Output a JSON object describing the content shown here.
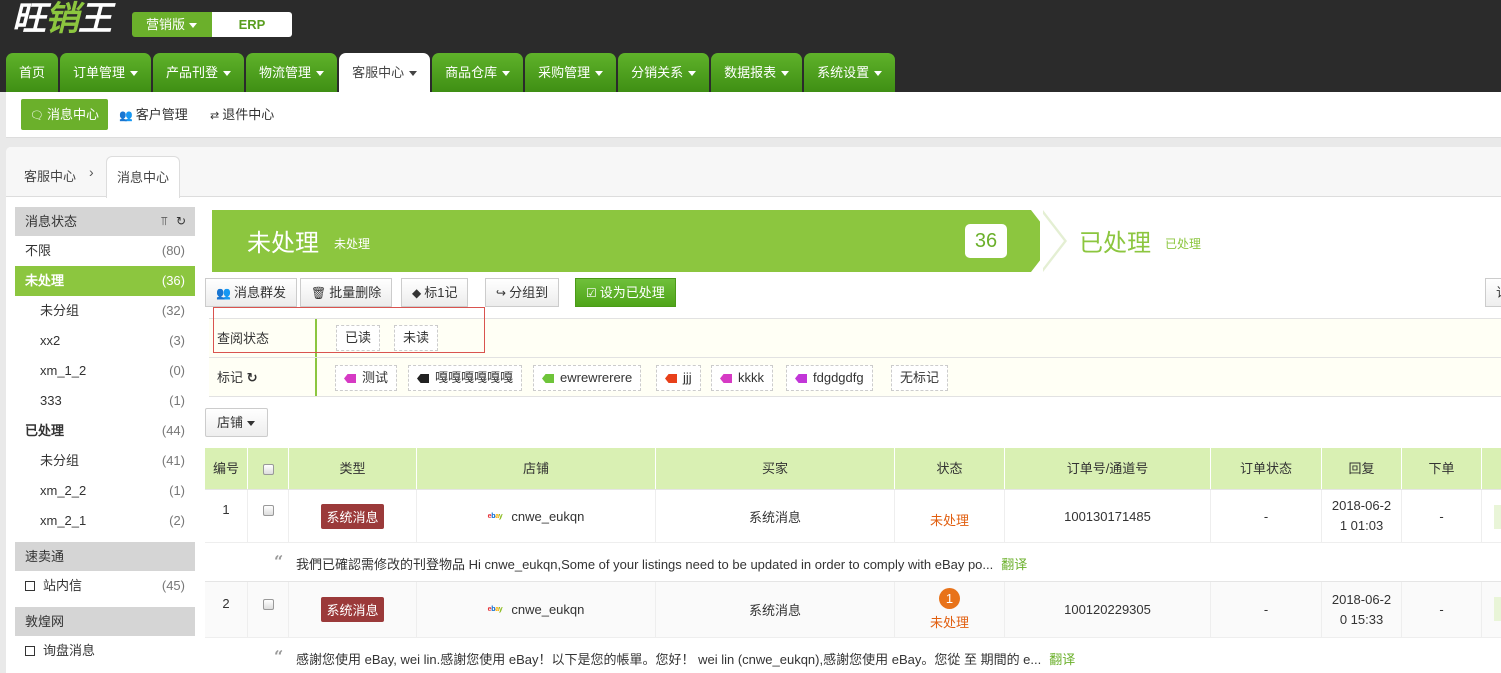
{
  "header": {
    "logo_main": "旺",
    "logo_accent": "销",
    "logo_end": "王",
    "version_label": "营销版",
    "erp_label": "ERP"
  },
  "nav": [
    {
      "label": "首页",
      "dropdown": false,
      "active": false
    },
    {
      "label": "订单管理",
      "dropdown": true,
      "active": false
    },
    {
      "label": "产品刊登",
      "dropdown": true,
      "active": false
    },
    {
      "label": "物流管理",
      "dropdown": true,
      "active": false
    },
    {
      "label": "客服中心",
      "dropdown": true,
      "active": true
    },
    {
      "label": "商品仓库",
      "dropdown": true,
      "active": false
    },
    {
      "label": "采购管理",
      "dropdown": true,
      "active": false
    },
    {
      "label": "分销关系",
      "dropdown": true,
      "active": false
    },
    {
      "label": "数据报表",
      "dropdown": true,
      "active": false
    },
    {
      "label": "系统设置",
      "dropdown": true,
      "active": false
    }
  ],
  "subnav": {
    "message_center": "消息中心",
    "customer_mgmt": "客户管理",
    "returns_center": "退件中心"
  },
  "breadcrumb": {
    "root": "客服中心",
    "sep": "›",
    "current": "消息中心"
  },
  "sidebar": {
    "status_header": "消息状态",
    "status_items": [
      {
        "label": "不限",
        "count": "(80)",
        "level": "top",
        "active": false,
        "bold": false
      },
      {
        "label": "未处理",
        "count": "(36)",
        "level": "top",
        "active": true,
        "bold": true
      },
      {
        "label": "未分组",
        "count": "(32)",
        "level": "sub",
        "active": false,
        "bold": false
      },
      {
        "label": "xx2",
        "count": "(3)",
        "level": "sub",
        "active": false,
        "bold": false
      },
      {
        "label": "xm_1_2",
        "count": "(0)",
        "level": "sub",
        "active": false,
        "bold": false
      },
      {
        "label": "333",
        "count": "(1)",
        "level": "sub",
        "active": false,
        "bold": false
      },
      {
        "label": "已处理",
        "count": "(44)",
        "level": "top",
        "active": false,
        "bold": true
      },
      {
        "label": "未分组",
        "count": "(41)",
        "level": "sub",
        "active": false,
        "bold": false
      },
      {
        "label": "xm_2_2",
        "count": "(1)",
        "level": "sub",
        "active": false,
        "bold": false
      },
      {
        "label": "xm_2_1",
        "count": "(2)",
        "level": "sub",
        "active": false,
        "bold": false
      }
    ],
    "aliexpress_header": "速卖通",
    "aliexpress_item": {
      "label": "站内信",
      "count": "(45)"
    },
    "dhgate_header": "敦煌网",
    "dhgate_item": {
      "label": "询盘消息",
      "count": ""
    }
  },
  "banner": {
    "unprocessed_title": "未处理",
    "unprocessed_sub": "未处理",
    "unprocessed_count": "36",
    "processed_title": "已处理",
    "processed_sub": "已处理"
  },
  "toolbar": {
    "bulk_send": "消息群发",
    "bulk_delete": "批量删除",
    "mark": "标1记",
    "group_to": "分组到",
    "set_processed": "设为已处理",
    "right_partial": "订"
  },
  "filters": {
    "read_label": "查阅状态",
    "read_options": [
      "已读",
      "未读"
    ],
    "tag_label": "标记",
    "tags": [
      {
        "label": "测试",
        "color": "#d63ac4"
      },
      {
        "label": "嘎嘎嘎嘎嘎嘎",
        "color": "#222222"
      },
      {
        "label": "ewrewrerere",
        "color": "#6ec43a"
      },
      {
        "label": "jjj",
        "color": "#e8401a"
      },
      {
        "label": "kkkk",
        "color": "#d63ac4"
      },
      {
        "label": "fdgdgdfg",
        "color": "#c236d8"
      }
    ],
    "no_tag": "无标记"
  },
  "store_dropdown": "店铺",
  "table": {
    "headers": [
      "编号",
      "",
      "类型",
      "店铺",
      "买家",
      "状态",
      "订单号/通道号",
      "订单状态",
      "回复",
      "下单"
    ],
    "rows": [
      {
        "num": "1",
        "type": "系统消息",
        "store": "cnwe_eukqn",
        "buyer": "系统消息",
        "unread": "",
        "status": "未处理",
        "order": "100130171485",
        "order_status": "-",
        "reply_line1": "2018-06-2",
        "reply_line2": "1 01:03",
        "placed": "-",
        "message": "我們已確認需修改的刊登物品 Hi cnwe_eukqn,Some of your listings need to be updated in order to comply with eBay po...",
        "translate": "翻译"
      },
      {
        "num": "2",
        "type": "系统消息",
        "store": "cnwe_eukqn",
        "buyer": "系统消息",
        "unread": "1",
        "status": "未处理",
        "order": "100120229305",
        "order_status": "-",
        "reply_line1": "2018-06-2",
        "reply_line2": "0 15:33",
        "placed": "-",
        "message": "感謝您使用 eBay, wei lin.感謝您使用 eBay！以下是您的帳單。您好！ wei lin (cnwe_eukqn),感謝您使用 eBay。您從 至 期間的 e...",
        "translate": "翻译"
      }
    ]
  },
  "colors": {
    "brand_green": "#8cc63f",
    "nav_green": "#4fa419",
    "header_dark": "#2b2b2b",
    "status_orange": "#e15f10",
    "system_badge": "#9b3a3a"
  }
}
